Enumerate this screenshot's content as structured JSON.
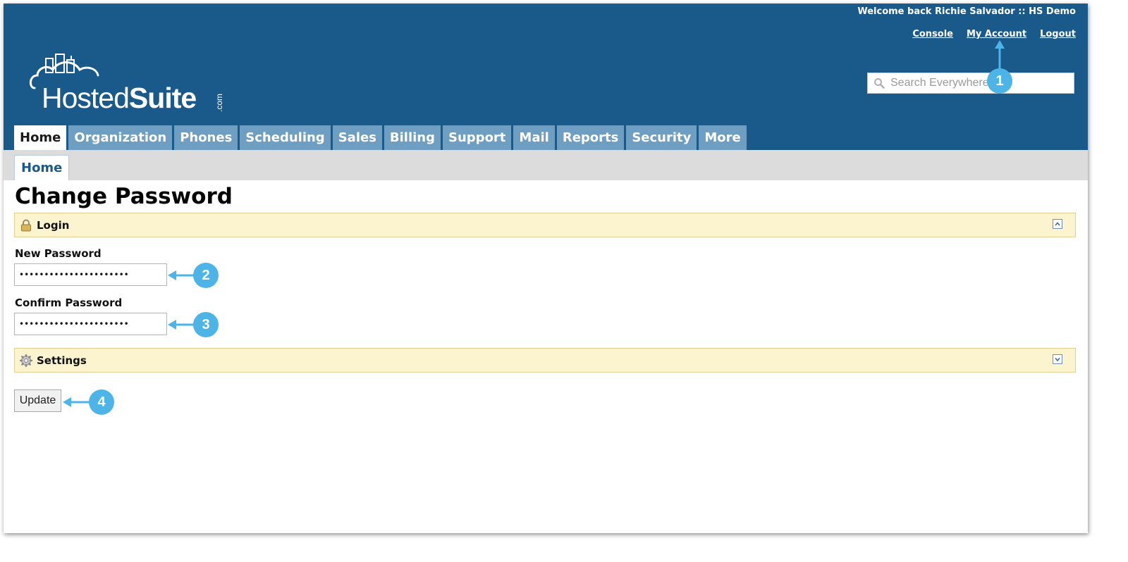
{
  "header": {
    "welcome": "Welcome back Richie Salvador :: HS Demo",
    "links": [
      "Console",
      "My Account",
      "Logout"
    ],
    "logo_text": "HostedSuite.com",
    "search_placeholder": "Search Everywhere"
  },
  "nav": {
    "tabs": [
      "Home",
      "Organization",
      "Phones",
      "Scheduling",
      "Sales",
      "Billing",
      "Support",
      "Mail",
      "Reports",
      "Security",
      "More"
    ],
    "active_tab": "Home",
    "subtabs": [
      "Home"
    ]
  },
  "page": {
    "title": "Change Password",
    "login_panel": {
      "title": "Login",
      "icon": "lock-icon",
      "state": "expanded"
    },
    "settings_panel": {
      "title": "Settings",
      "icon": "gear-icon",
      "state": "collapsed"
    },
    "new_password_label": "New Password",
    "new_password_value": "••••••••••••••••••••••",
    "confirm_password_label": "Confirm Password",
    "confirm_password_value": "••••••••••••••••••••••",
    "update_button": "Update"
  },
  "callouts": [
    "1",
    "2",
    "3",
    "4"
  ],
  "colors": {
    "header_bg": "#1a5a8b",
    "tab_bg": "#6e9ec2",
    "panel_bg": "#fcf4cf",
    "callout": "#4cb4e6"
  }
}
